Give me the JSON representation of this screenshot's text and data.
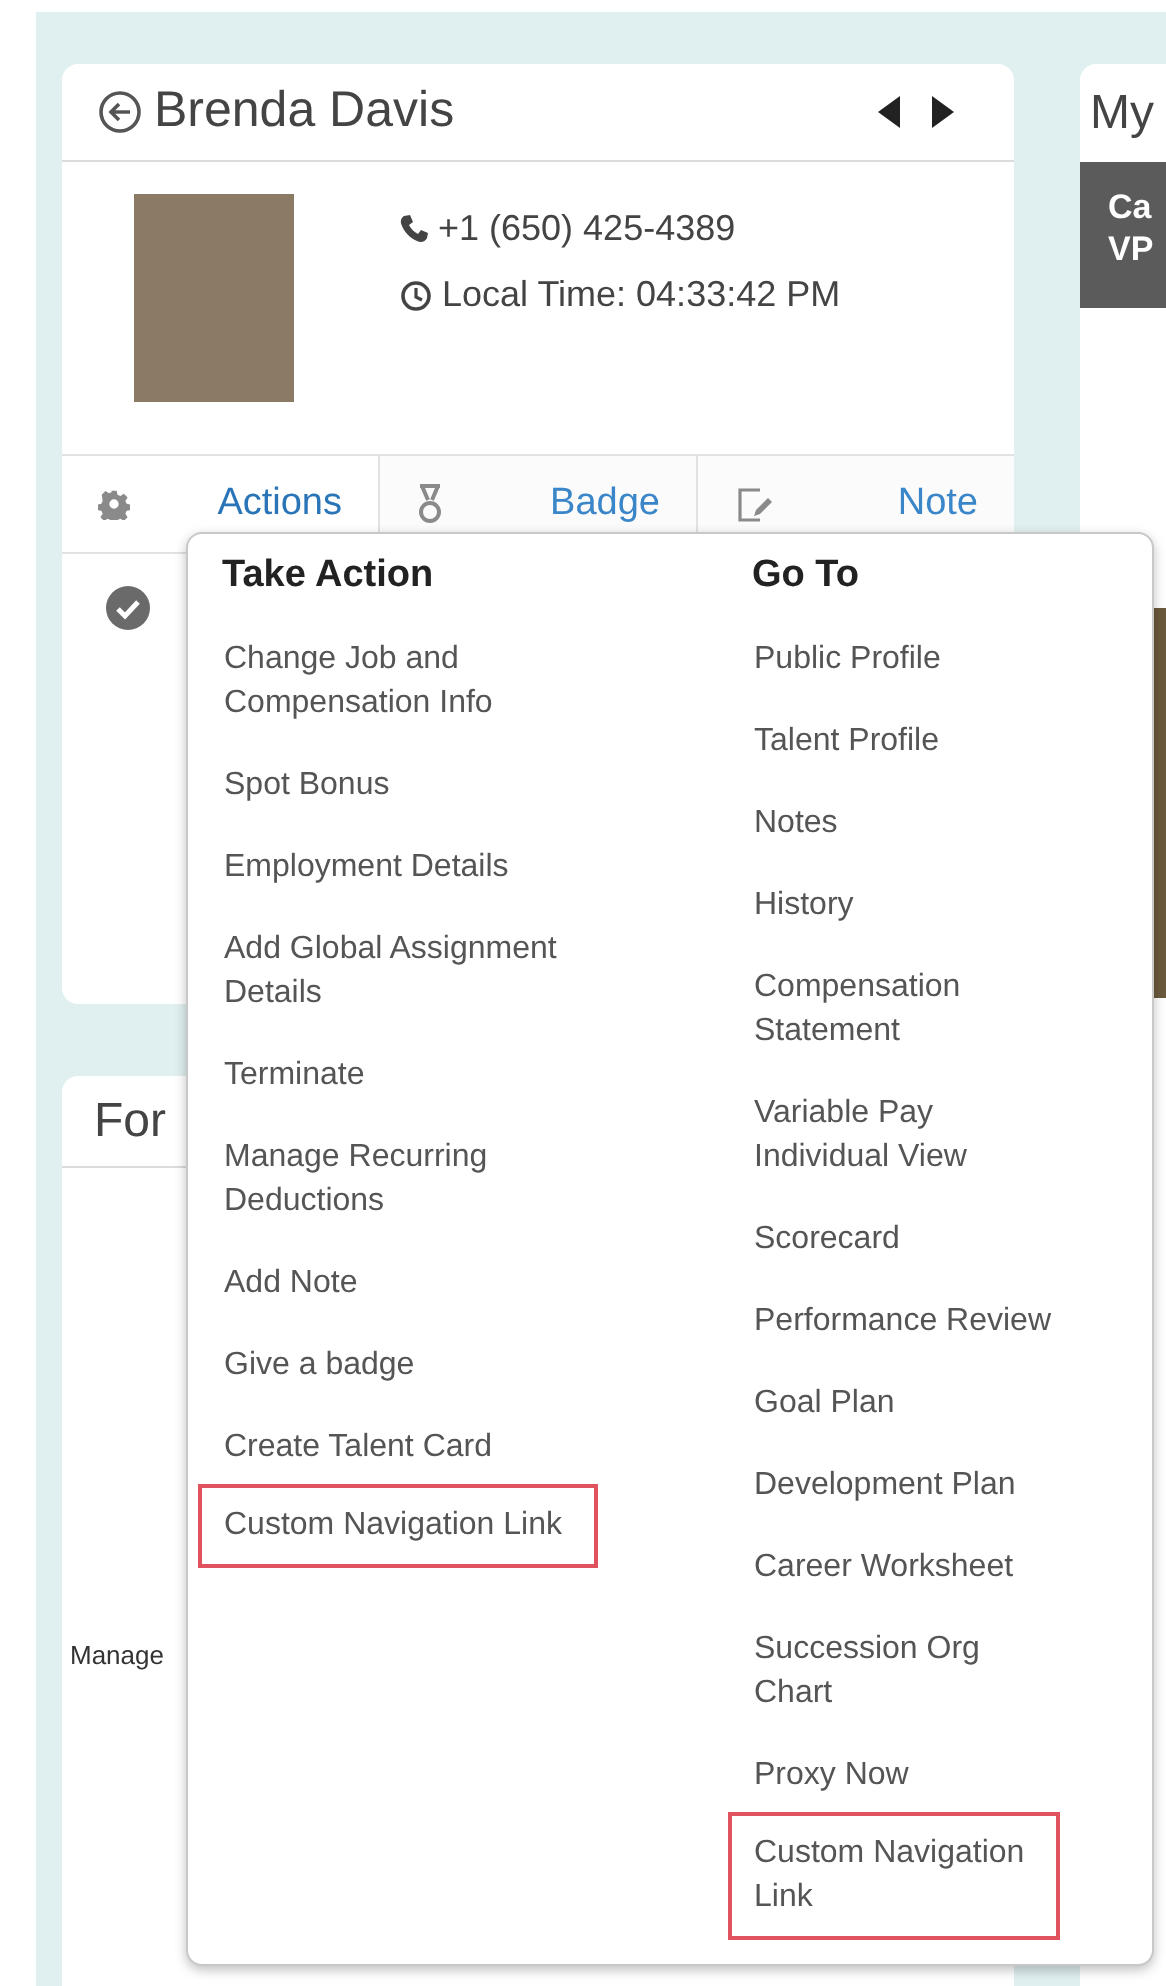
{
  "profile_card": {
    "title": "Brenda Davis",
    "phone": "+1 (650) 425-4389",
    "local_time": "Local Time: 04:33:42 PM",
    "actions": [
      {
        "kind": "actions",
        "label": "Actions",
        "selected": true
      },
      {
        "kind": "badge",
        "label": "Badge",
        "selected": false
      },
      {
        "kind": "note",
        "label": "Note",
        "selected": false
      }
    ]
  },
  "form_card": {
    "title": "For",
    "label": "Manage"
  },
  "right_card": {
    "title": "My",
    "banner_line_1": "Ca",
    "banner_line_2": "VP"
  },
  "dropdown": {
    "columns": [
      {
        "heading": "Take Action",
        "items": [
          {
            "label": "Change Job and\nCompensation Info",
            "highlighted": false
          },
          {
            "label": "Spot Bonus",
            "highlighted": false
          },
          {
            "label": "Employment Details",
            "highlighted": false
          },
          {
            "label": "Add Global Assignment\nDetails",
            "highlighted": false
          },
          {
            "label": "Terminate",
            "highlighted": false
          },
          {
            "label": "Manage Recurring\nDeductions",
            "highlighted": false
          },
          {
            "label": "Add Note",
            "highlighted": false
          },
          {
            "label": "Give a badge",
            "highlighted": false
          },
          {
            "label": "Create Talent Card",
            "highlighted": false
          },
          {
            "label": "Custom Navigation Link",
            "highlighted": true
          }
        ]
      },
      {
        "heading": "Go To",
        "items": [
          {
            "label": "Public Profile",
            "highlighted": false
          },
          {
            "label": "Talent Profile",
            "highlighted": false
          },
          {
            "label": "Notes",
            "highlighted": false
          },
          {
            "label": "History",
            "highlighted": false
          },
          {
            "label": "Compensation\nStatement",
            "highlighted": false
          },
          {
            "label": "Variable Pay\nIndividual View",
            "highlighted": false
          },
          {
            "label": "Scorecard",
            "highlighted": false
          },
          {
            "label": "Performance Review",
            "highlighted": false
          },
          {
            "label": "Goal Plan",
            "highlighted": false
          },
          {
            "label": "Development Plan",
            "highlighted": false
          },
          {
            "label": "Career Worksheet",
            "highlighted": false
          },
          {
            "label": "Succession Org\nChart",
            "highlighted": false
          },
          {
            "label": "Proxy Now",
            "highlighted": false
          },
          {
            "label": "Custom Navigation\nLink",
            "highlighted": true
          }
        ]
      }
    ]
  }
}
